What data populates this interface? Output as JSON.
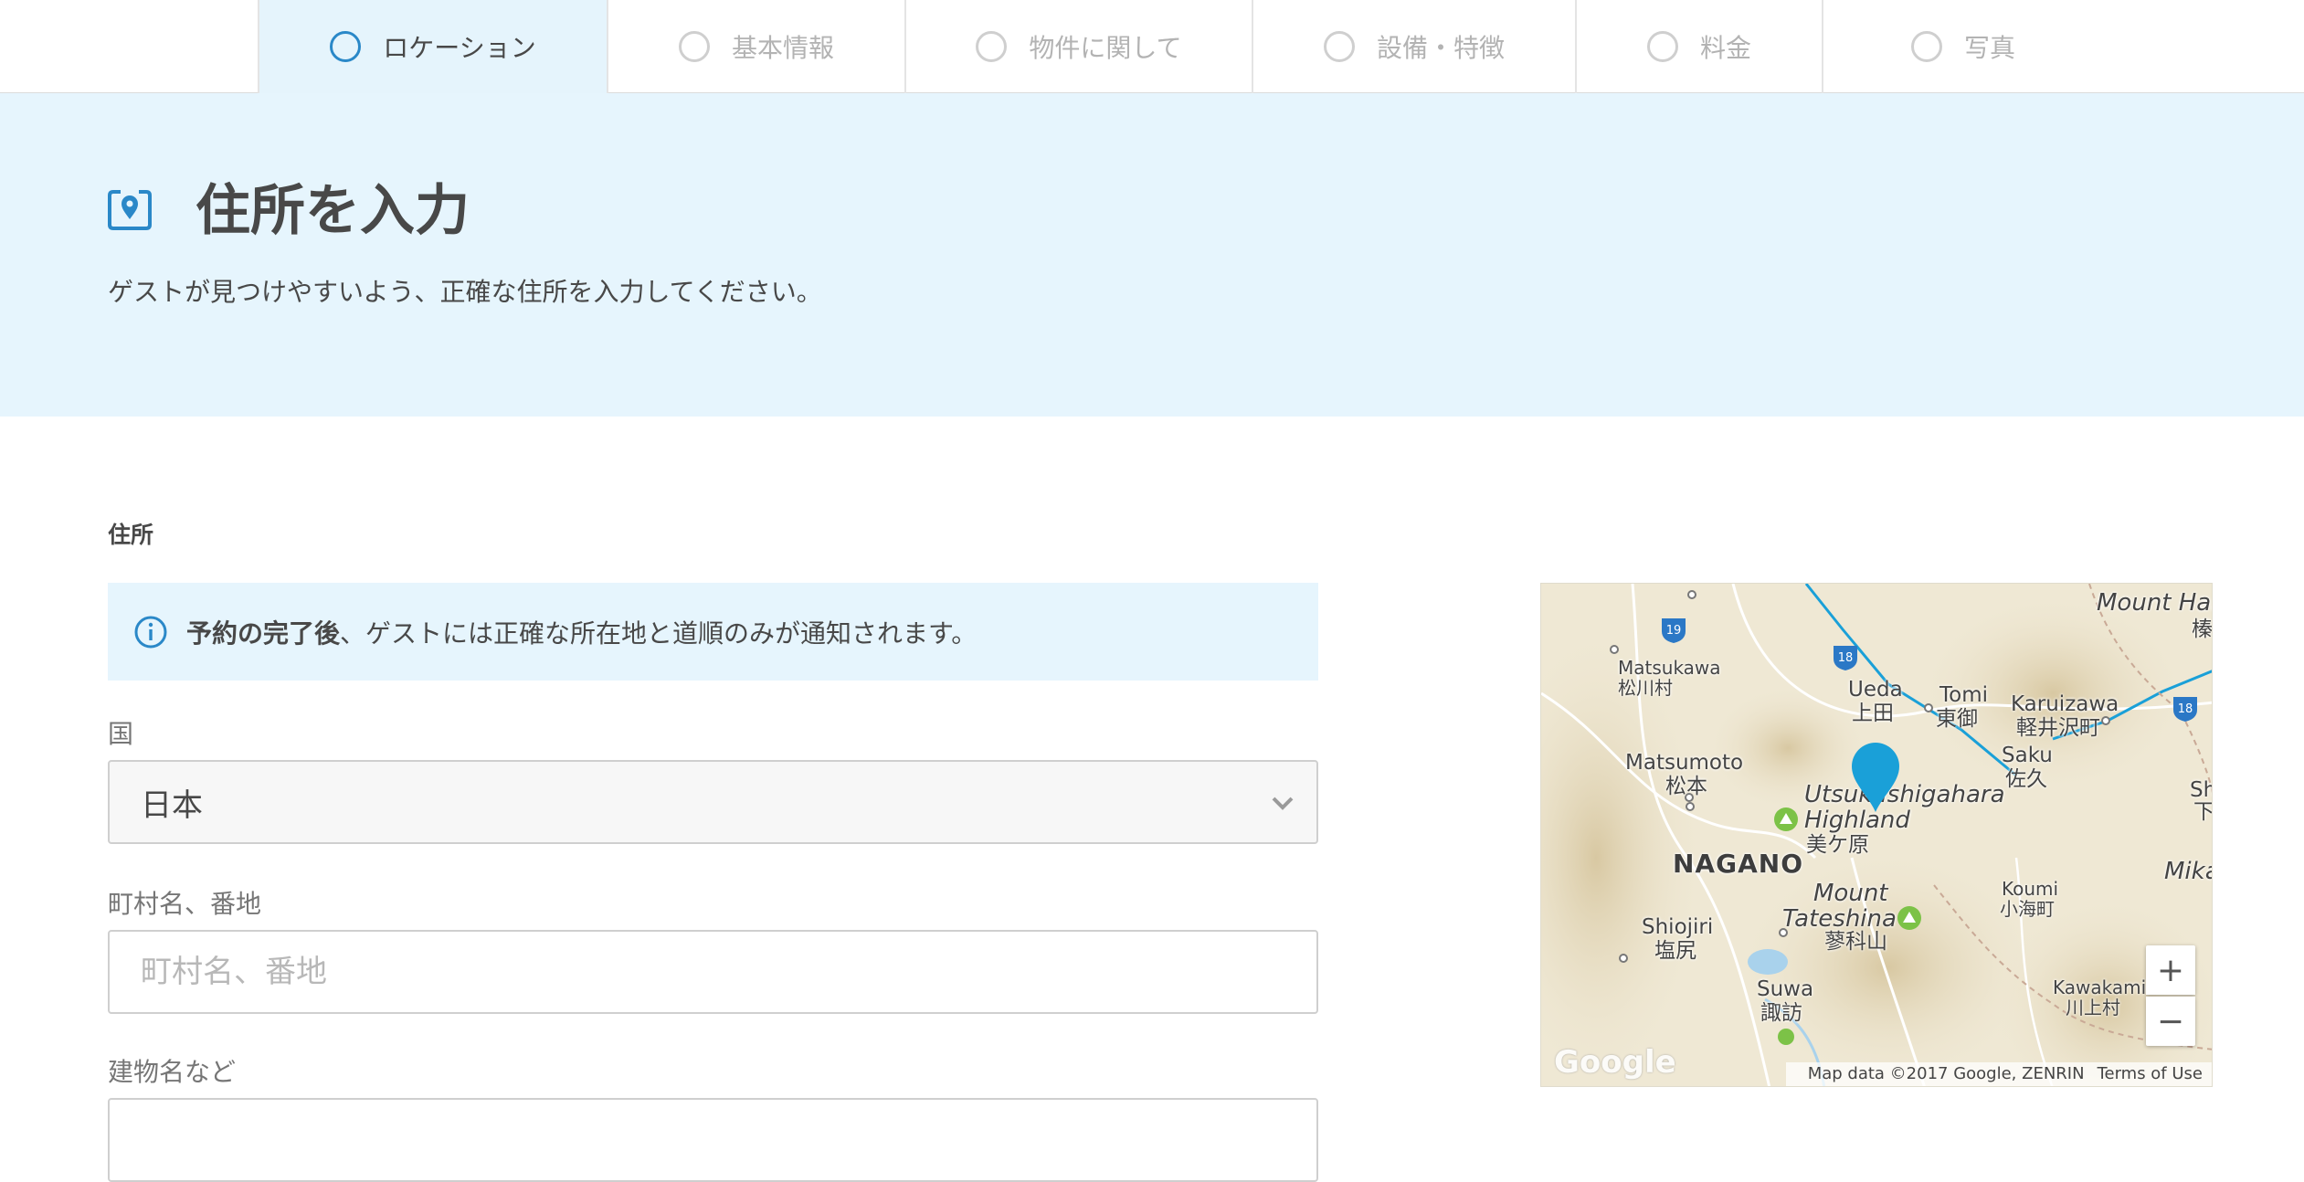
{
  "stepper": {
    "steps": [
      {
        "label": "ロケーション",
        "active": true
      },
      {
        "label": "基本情報",
        "active": false
      },
      {
        "label": "物件に関して",
        "active": false
      },
      {
        "label": "設備・特徴",
        "active": false
      },
      {
        "label": "料金",
        "active": false
      },
      {
        "label": "写真",
        "active": false
      }
    ]
  },
  "hero": {
    "icon": "location-pin-icon",
    "title": "住所を入力",
    "subtitle": "ゲストが見つけやすいよう、正確な住所を入力してください。"
  },
  "form": {
    "section_label": "住所",
    "notice": {
      "icon": "info-icon",
      "bold": "予約の完了後",
      "text": "、ゲストには正確な所在地と道順のみが通知されます。"
    },
    "country": {
      "label": "国",
      "value": "日本"
    },
    "street": {
      "label": "町村名、番地",
      "placeholder": "町村名、番地",
      "value": ""
    },
    "building": {
      "label": "建物名など"
    }
  },
  "map": {
    "labels": {
      "mount_har": "Mount Har",
      "mount_har_jp": "榛",
      "matsukawa": "Matsukawa",
      "matsukawa_jp": "松川村",
      "ueda": "Ueda",
      "ueda_jp": "上田",
      "tomi": "Tomi",
      "tomi_jp": "東御",
      "karuizawa": "Karuizawa",
      "karuizawa_jp": "軽井沢町",
      "matsumoto": "Matsumoto",
      "matsumoto_jp": "松本",
      "saku": "Saku",
      "saku_jp": "佐久",
      "utsukushigahara": "Utsukushigahara",
      "highland": "Highland",
      "utsukushigahara_jp": "美ケ原",
      "nagano": "NAGANO",
      "shi": "Shi",
      "shi_jp": "下",
      "mika": "Mika",
      "koumi": "Koumi",
      "koumi_jp": "小海町",
      "mount": "Mount",
      "tateshina": "Tateshina",
      "tateshina_jp": "蓼科山",
      "shiojiri": "Shiojiri",
      "shiojiri_jp": "塩尻",
      "suwa": "Suwa",
      "suwa_jp": "諏訪",
      "kawakami": "Kawakami",
      "kawakami_jp": "川上村"
    },
    "route_shields": [
      "19",
      "18",
      "18"
    ],
    "zoom_in": "+",
    "zoom_out": "−",
    "logo": "Google",
    "attribution": "Map data ©2017 Google, ZENRIN",
    "terms": "Terms of Use"
  },
  "colors": {
    "accent": "#2a88c8",
    "hero_bg": "#e6f5fd",
    "marker": "#1aa0d8"
  }
}
